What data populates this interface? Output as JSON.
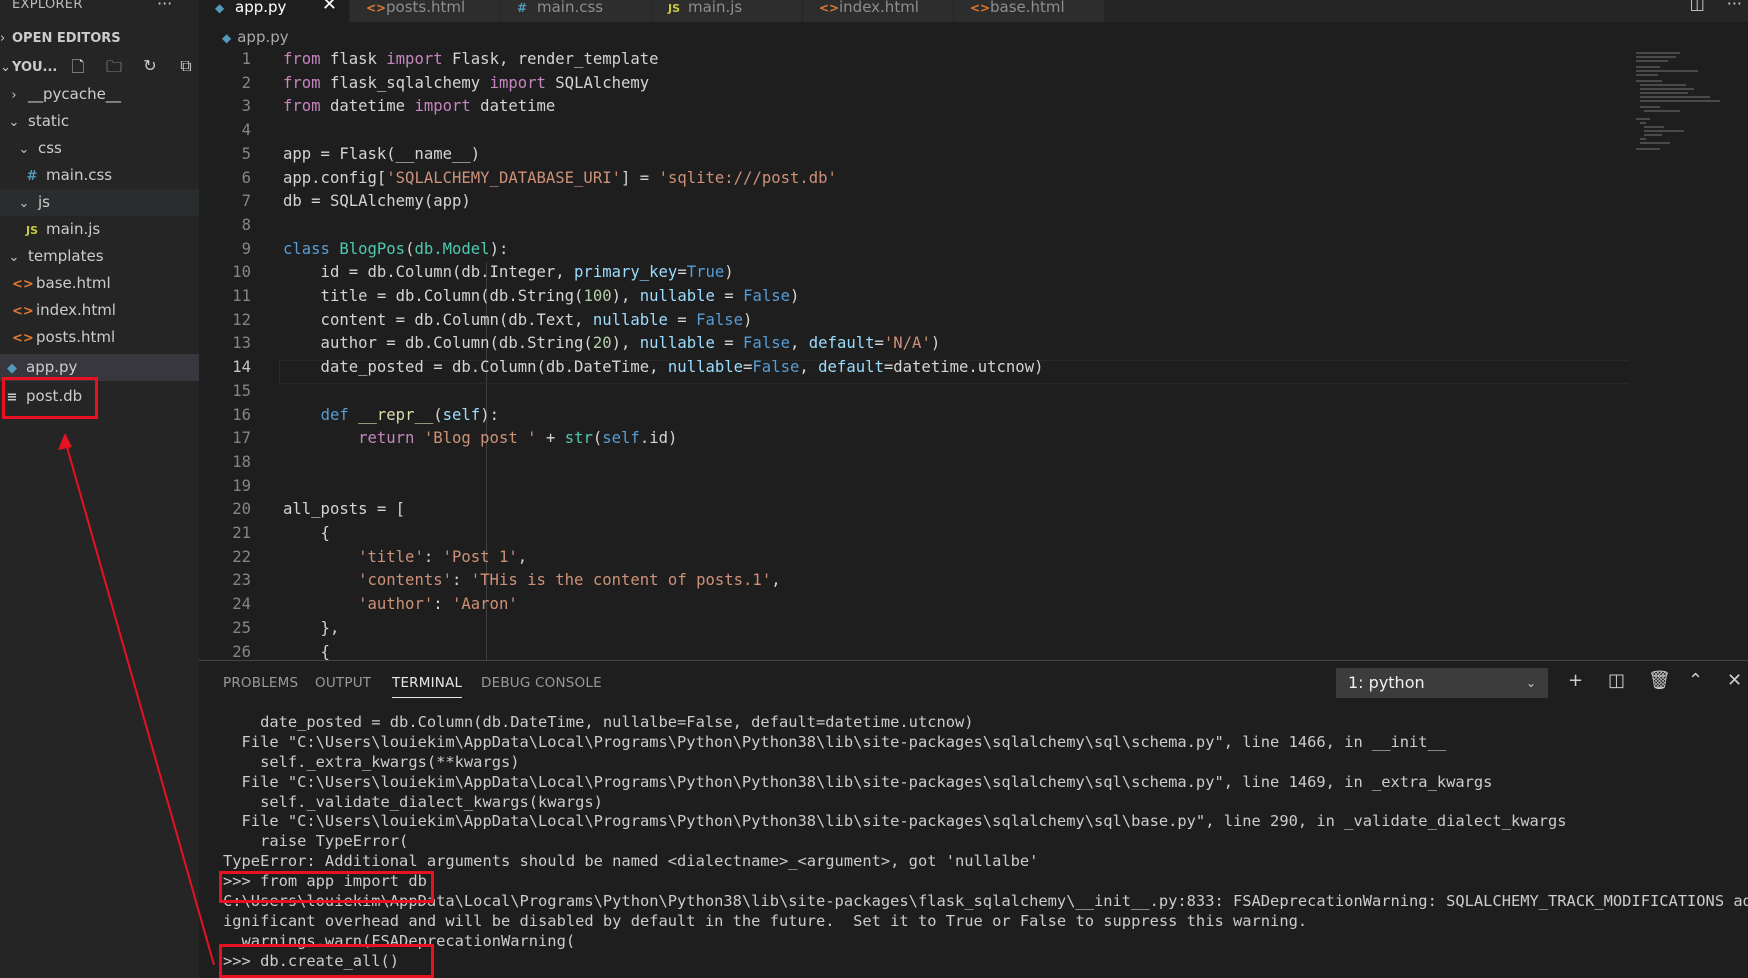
{
  "sidebar": {
    "title": "EXPLORER",
    "more": "···",
    "open_editors": "OPEN EDITORS",
    "workspace": "YOU...",
    "tree": [
      {
        "label": "__pycache__",
        "icon": "chevron-right",
        "depth": 0
      },
      {
        "label": "static",
        "icon": "chevron-down",
        "depth": 0
      },
      {
        "label": "css",
        "icon": "chevron-down",
        "depth": 1
      },
      {
        "label": "main.css",
        "icon": "css-file",
        "depth": 2,
        "glyph": "#"
      },
      {
        "label": "js",
        "icon": "chevron-down",
        "depth": 1
      },
      {
        "label": "main.js",
        "icon": "js-file",
        "depth": 2,
        "glyph": "JS"
      },
      {
        "label": "templates",
        "icon": "chevron-down",
        "depth": 0
      },
      {
        "label": "base.html",
        "icon": "html-file",
        "depth": 1,
        "glyph": "<>"
      },
      {
        "label": "index.html",
        "icon": "html-file",
        "depth": 1,
        "glyph": "<>"
      },
      {
        "label": "posts.html",
        "icon": "html-file",
        "depth": 1,
        "glyph": "<>"
      },
      {
        "label": "app.py",
        "icon": "python-file",
        "depth": 0,
        "glyph": "◆"
      },
      {
        "label": "post.db",
        "icon": "db-file",
        "depth": 0,
        "glyph": "≡"
      }
    ]
  },
  "tabs": [
    {
      "label": "app.py",
      "glyph": "◆",
      "active": true
    },
    {
      "label": "posts.html",
      "glyph": "<>"
    },
    {
      "label": "main.css",
      "glyph": "#"
    },
    {
      "label": "main.js",
      "glyph": "JS"
    },
    {
      "label": "index.html",
      "glyph": "<>"
    },
    {
      "label": "base.html",
      "glyph": "<>"
    }
  ],
  "breadcrumb": "app.py",
  "editor": {
    "line_numbers": [
      "1",
      "2",
      "3",
      "4",
      "5",
      "6",
      "7",
      "8",
      "9",
      "10",
      "11",
      "12",
      "13",
      "14",
      "15",
      "16",
      "17",
      "18",
      "19",
      "20",
      "21",
      "22",
      "23",
      "24",
      "25",
      "26"
    ]
  },
  "panel": {
    "tabs": [
      "PROBLEMS",
      "OUTPUT",
      "TERMINAL",
      "DEBUG CONSOLE"
    ],
    "terminal_select": "1: python",
    "terminal_lines": [
      "    date_posted = db.Column(db.DateTime, nullalbe=False, default=datetime.utcnow)",
      "  File \"C:\\Users\\louiekim\\AppData\\Local\\Programs\\Python\\Python38\\lib\\site-packages\\sqlalchemy\\sql\\schema.py\", line 1466, in __init__",
      "    self._extra_kwargs(**kwargs)",
      "  File \"C:\\Users\\louiekim\\AppData\\Local\\Programs\\Python\\Python38\\lib\\site-packages\\sqlalchemy\\sql\\schema.py\", line 1469, in _extra_kwargs",
      "    self._validate_dialect_kwargs(kwargs)",
      "  File \"C:\\Users\\louiekim\\AppData\\Local\\Programs\\Python\\Python38\\lib\\site-packages\\sqlalchemy\\sql\\base.py\", line 290, in _validate_dialect_kwargs",
      "    raise TypeError(",
      "TypeError: Additional arguments should be named <dialectname>_<argument>, got 'nullalbe'",
      ">>> from app import db",
      "C:\\Users\\louiekim\\AppData\\Local\\Programs\\Python\\Python38\\lib\\site-packages\\flask_sqlalchemy\\__init__.py:833: FSADeprecationWarning: SQLALCHEMY_TRACK_MODIFICATIONS adds s",
      "ignificant overhead and will be disabled by default in the future.  Set it to True or False to suppress this warning.",
      "  warnings.warn(FSADeprecationWarning(",
      ">>> db.create_all()"
    ]
  },
  "colors": {
    "accent_annotation": "#e81123",
    "background": "#1e1e1e",
    "sidebar": "#252526"
  }
}
